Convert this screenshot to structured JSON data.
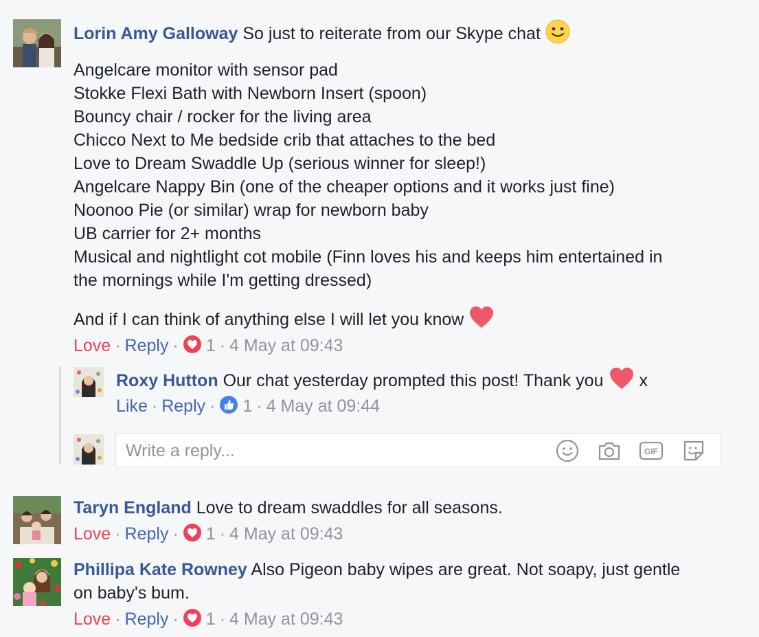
{
  "comments": [
    {
      "author": "Lorin Amy Galloway",
      "first_line": "So just to reiterate from our Skype chat",
      "list": [
        "Angelcare monitor with sensor pad",
        "Stokke Flexi Bath with Newborn Insert (spoon)",
        "Bouncy chair / rocker for the living area",
        "Chicco Next to Me bedside crib that attaches to the bed",
        "Love to Dream Swaddle Up (serious winner for sleep!)",
        "Angelcare Nappy Bin (one of the cheaper options and it works just fine)",
        "Noonoo Pie (or similar) wrap for newborn baby",
        "UB carrier for 2+ months",
        "Musical and nightlight cot mobile (Finn loves his and keeps him entertained in",
        "the mornings while I'm getting dressed)"
      ],
      "closing": "And if I can think of anything else I will let you know",
      "reaction_label": "Love",
      "reply_label": "Reply",
      "reaction_icon": "love-reaction-icon",
      "count": "1",
      "time": "4 May at 09:43"
    },
    {
      "author": "Taryn England",
      "text": "Love to dream swaddles for all seasons.",
      "reaction_label": "Love",
      "reply_label": "Reply",
      "reaction_icon": "love-reaction-icon",
      "count": "1",
      "time": "4 May at 09:43"
    },
    {
      "author": "Phillipa Kate Rowney",
      "text_line1": "Also Pigeon baby wipes are great. Not soapy, just gentle",
      "text_line2": "on baby's bum.",
      "reaction_label": "Love",
      "reply_label": "Reply",
      "reaction_icon": "love-reaction-icon",
      "count": "1",
      "time": "4 May at 09:43"
    }
  ],
  "reply": {
    "author": "Roxy Hutton",
    "text": "Our chat yesterday prompted this post! Thank you",
    "suffix": "x",
    "reaction_label": "Like",
    "reply_label": "Reply",
    "reaction_icon": "like-reaction-icon",
    "count": "1",
    "time": "4 May at 09:44"
  },
  "composer": {
    "placeholder": "Write a reply...",
    "icons": [
      "smiley-icon",
      "camera-icon",
      "gif-icon",
      "sticker-icon"
    ]
  },
  "colors": {
    "name": "#365899",
    "link": "#4267b2",
    "love": "#f33e58",
    "meta": "#90949c",
    "background": "#f6f7f9"
  }
}
